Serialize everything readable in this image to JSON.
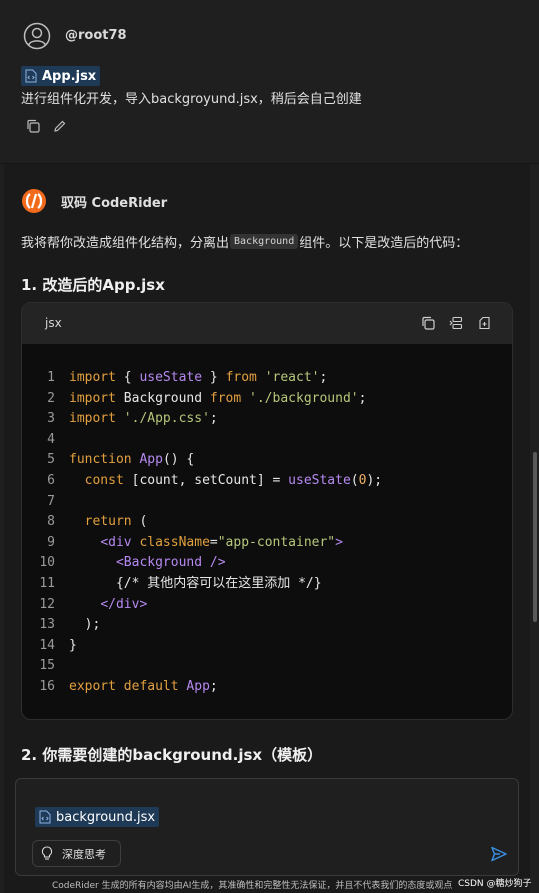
{
  "user": {
    "username": "@root78",
    "attachment": "App.jsx",
    "message": "进行组件化开发，导入backgroyund.jsx，稍后会自己创建",
    "actions": [
      "copy-icon",
      "edit-icon"
    ]
  },
  "assistant": {
    "name": "驭码 CodeRider",
    "intro_before": "我将帮你改造成组件化结构，分离出",
    "intro_code": "Background",
    "intro_after": "组件。以下是改造后的代码：",
    "heading1": "1. 改造后的App.jsx",
    "heading2": "2. 你需要创建的background.jsx（模板）",
    "code_block": {
      "language": "jsx",
      "header_actions": [
        "copy-icon",
        "insert-icon",
        "new-file-icon"
      ],
      "lines": [
        {
          "n": "1",
          "text": "import { useState } from 'react';"
        },
        {
          "n": "2",
          "text": "import Background from './background';"
        },
        {
          "n": "3",
          "text": "import './App.css';"
        },
        {
          "n": "4",
          "text": ""
        },
        {
          "n": "5",
          "text": "function App() {"
        },
        {
          "n": "6",
          "text": "  const [count, setCount] = useState(0);"
        },
        {
          "n": "7",
          "text": ""
        },
        {
          "n": "8",
          "text": "  return ("
        },
        {
          "n": "9",
          "text": "    <div className=\"app-container\">"
        },
        {
          "n": "10",
          "text": "      <Background />"
        },
        {
          "n": "11",
          "text": "      {/* 其他内容可以在这里添加 */}"
        },
        {
          "n": "12",
          "text": "    </div>"
        },
        {
          "n": "13",
          "text": "  );"
        },
        {
          "n": "14",
          "text": "}"
        },
        {
          "n": "15",
          "text": ""
        },
        {
          "n": "16",
          "text": "export default App;"
        }
      ]
    }
  },
  "composer": {
    "attachment": "background.jsx",
    "think_button": "深度思考",
    "send_icon": "send-icon"
  },
  "footer": {
    "note": "CodeRider 生成的所有内容均由AI生成，其准确性和完整性无法保证，并且不代表我们的态度或观点",
    "watermark": "CSDN @糖炒狗子"
  },
  "colors": {
    "background": "#1f1f1f",
    "assistant_background": "#1a1a1a",
    "code_background": "#0d0d0d",
    "chip": "#1e3a57",
    "keyword": "#e2a03f",
    "string": "#b5c77a",
    "function": "#b689f0",
    "send": "#3b8ee0",
    "logo": "#f26b1d"
  }
}
